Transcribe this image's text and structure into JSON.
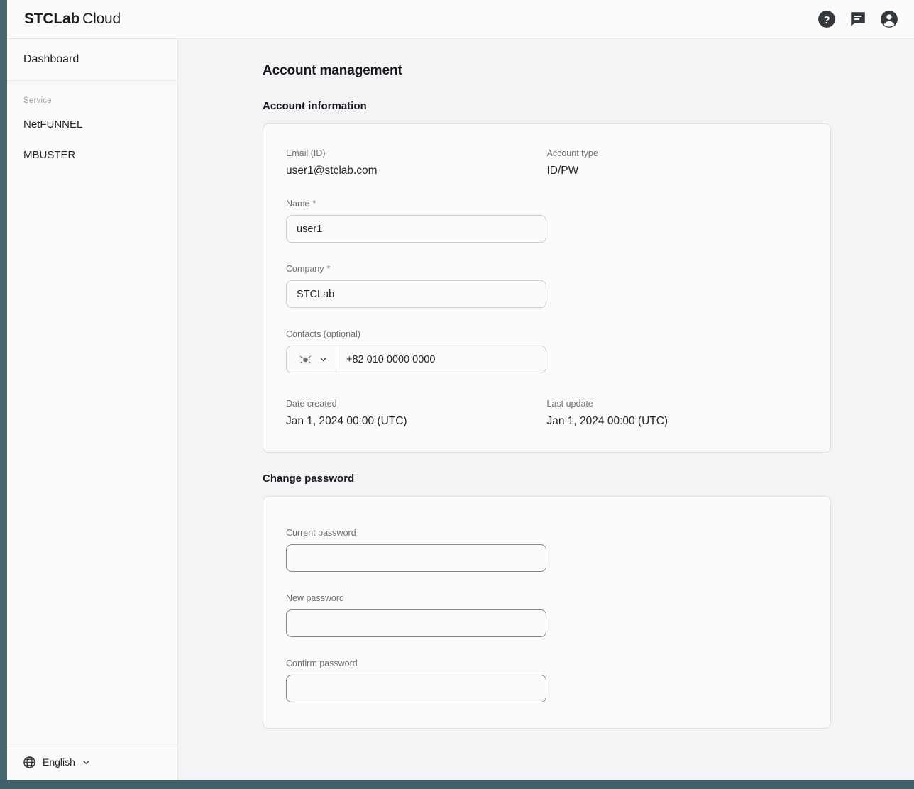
{
  "header": {
    "logo_brand": "STCLab",
    "logo_suffix": "Cloud",
    "icons": [
      "help-icon",
      "chat-icon",
      "account-icon"
    ]
  },
  "sidebar": {
    "dashboard_label": "Dashboard",
    "group_label": "Service",
    "items": [
      {
        "label": "NetFUNNEL"
      },
      {
        "label": "MBUSTER"
      }
    ],
    "language": {
      "label": "English",
      "icon": "globe-icon",
      "chevron": "chevron-down-icon"
    }
  },
  "main": {
    "page_title": "Account management",
    "account_section": {
      "title": "Account information",
      "email_label": "Email (ID)",
      "email_value": "user1@stclab.com",
      "account_type_label": "Account type",
      "account_type_value": "ID/PW",
      "name_label": "Name",
      "name_required": "*",
      "name_value": "user1",
      "company_label": "Company",
      "company_required": "*",
      "company_value": "STCLab",
      "contacts_label": "Contacts (optional)",
      "contacts_country": "KR",
      "contacts_placeholder": "+82 010 0000 0000",
      "date_created_label": "Date created",
      "date_created_value": "Jan 1, 2024 00:00 (UTC)",
      "last_update_label": "Last update",
      "last_update_value": "Jan 1, 2024 00:00 (UTC)"
    },
    "password_section": {
      "title": "Change password",
      "current_label": "Current password",
      "current_value": "",
      "new_label": "New password",
      "new_value": "",
      "confirm_label": "Confirm password",
      "confirm_value": ""
    }
  },
  "colors": {
    "page_bg": "#f3f4f6",
    "panel_bg": "#fafafa",
    "border": "#dcdee1",
    "text": "#24262a",
    "muted": "#6e7278",
    "edge_strip": "#4a666e"
  }
}
